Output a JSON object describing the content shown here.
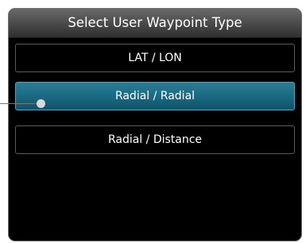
{
  "dialog": {
    "title": "Select User Waypoint Type"
  },
  "options": [
    {
      "label": "LAT / LON",
      "selected": false
    },
    {
      "label": "Radial / Radial",
      "selected": true
    },
    {
      "label": "Radial / Distance",
      "selected": false
    }
  ],
  "colors": {
    "panel_background": "#000000",
    "title_bar": "#4e4e4e",
    "selected_row": "#1a6a82",
    "text": "#ffffff"
  }
}
